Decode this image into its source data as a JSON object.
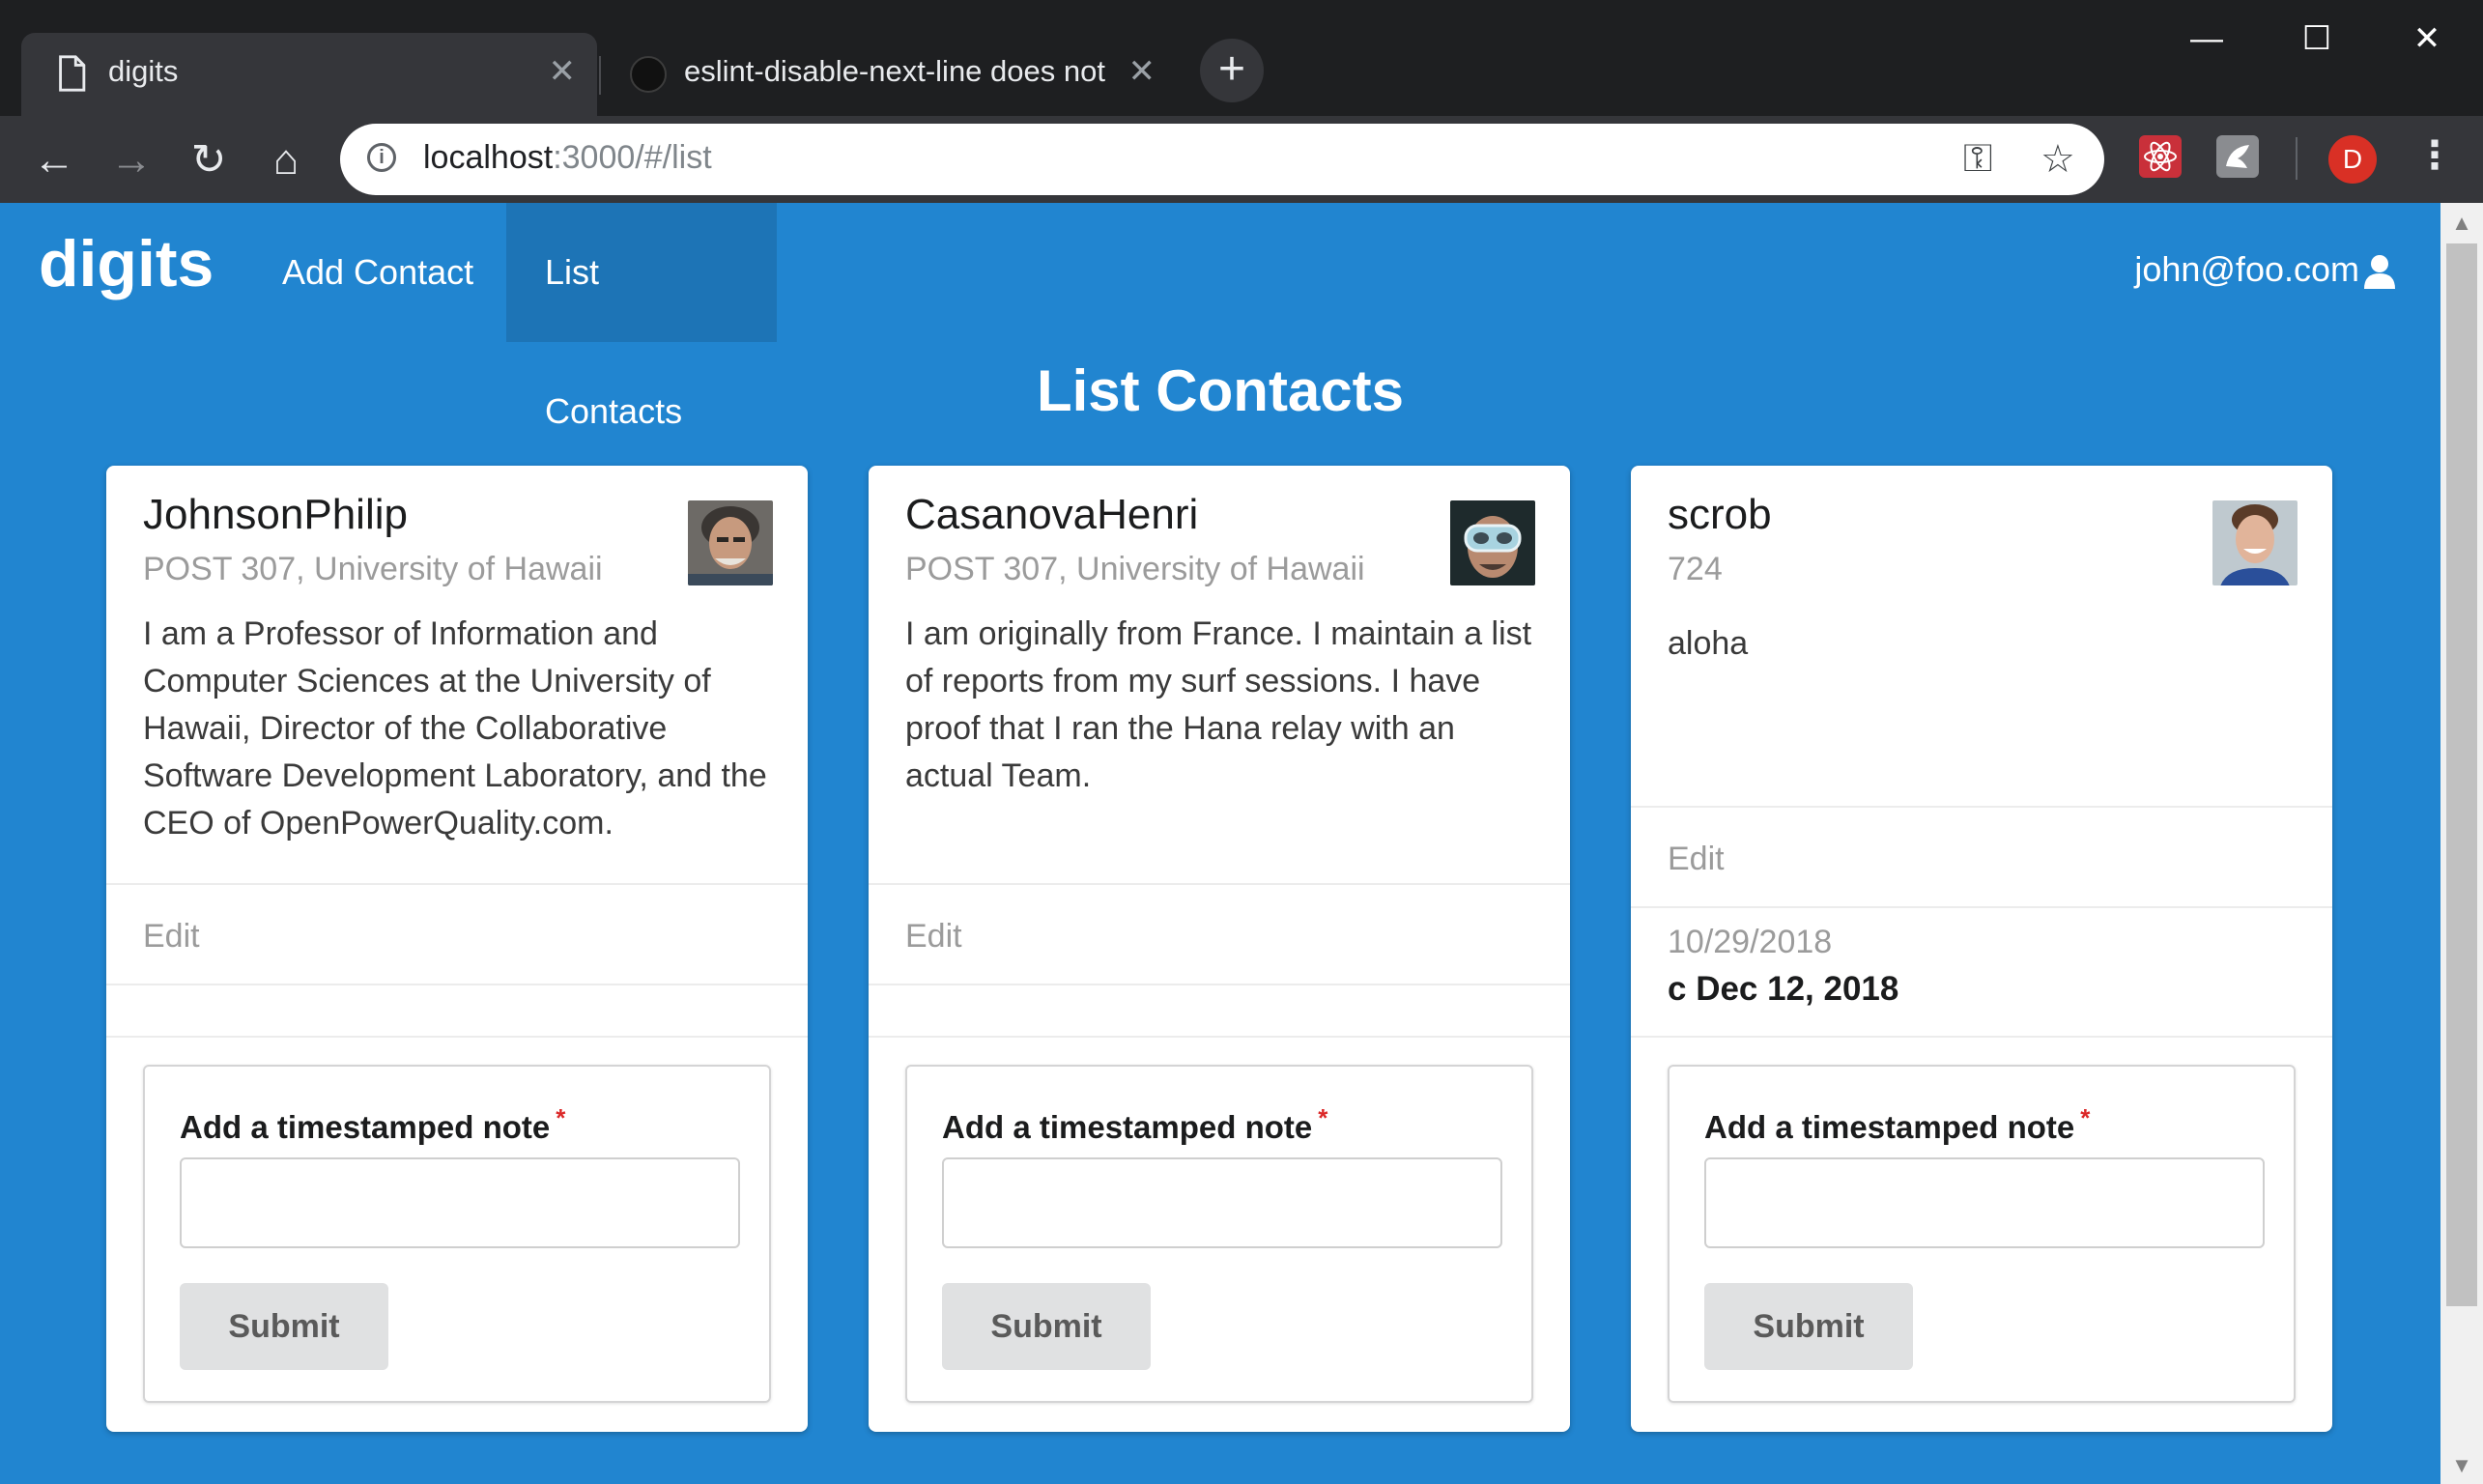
{
  "browser": {
    "tabs": [
      {
        "title": "digits",
        "active": true,
        "icon": "page-icon"
      },
      {
        "title": "eslint-disable-next-line does not",
        "active": false,
        "icon": "github-icon"
      }
    ],
    "new_tab": "+",
    "window_controls": {
      "minimize": "—",
      "maximize": "☐",
      "close": "✕"
    },
    "nav": {
      "back": "←",
      "forward": "→",
      "reload": "↻",
      "home": "⌂"
    },
    "url_host": "localhost",
    "url_rest": ":3000/#/list",
    "info_icon": "i",
    "key_icon": "⚿",
    "star_icon": "☆",
    "profile_initial": "D",
    "menu_icon": "⋮"
  },
  "nav": {
    "brand": "digits",
    "items": [
      {
        "label": "Add Contact",
        "active": false
      },
      {
        "label": "List Contacts",
        "active": true
      }
    ],
    "user": "john@foo.com"
  },
  "page_title": "List Contacts",
  "contacts": [
    {
      "name": "JohnsonPhilip",
      "address": "POST 307, University of Hawaii",
      "description": "I am a Professor of Information and Computer Sciences at the University of Hawaii, Director of the Collaborative Software Development Laboratory, and the CEO of OpenPowerQuality.com.",
      "edit_label": "Edit",
      "form": {
        "label": "Add a timestamped note",
        "required_mark": "*",
        "input_value": "",
        "submit_label": "Submit"
      }
    },
    {
      "name": "CasanovaHenri",
      "address": "POST 307, University of Hawaii",
      "description": "I am originally from France. I maintain a list of reports from my surf sessions. I have proof that I ran the Hana relay with an actual Team.",
      "edit_label": "Edit",
      "form": {
        "label": "Add a timestamped note",
        "required_mark": "*",
        "input_value": "",
        "submit_label": "Submit"
      }
    },
    {
      "name": "scrob",
      "address": "724",
      "description": "aloha",
      "edit_label": "Edit",
      "event": {
        "date": "10/29/2018",
        "note": "c Dec 12, 2018"
      },
      "form": {
        "label": "Add a timestamped note",
        "required_mark": "*",
        "input_value": "",
        "submit_label": "Submit"
      }
    }
  ],
  "colors": {
    "page_bg": "#2185d0",
    "card_bg": "#ffffff",
    "required": "#db2828",
    "button_bg": "#e0e1e2"
  }
}
